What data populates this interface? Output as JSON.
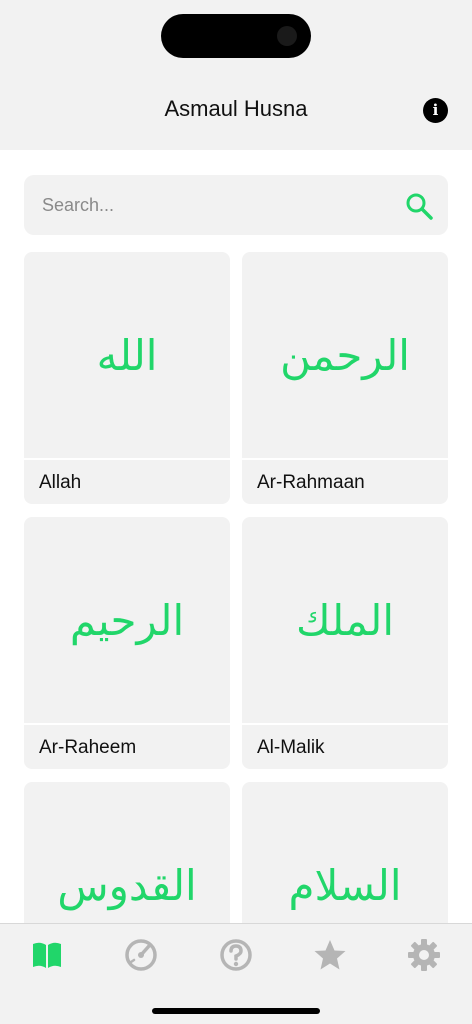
{
  "header": {
    "title": "Asmaul Husna",
    "info_icon": "info-icon"
  },
  "search": {
    "placeholder": "Search...",
    "icon": "search-icon"
  },
  "names": [
    {
      "arabic": "الله",
      "transliteration": "Allah"
    },
    {
      "arabic": "الرحمن",
      "transliteration": "Ar-Rahmaan"
    },
    {
      "arabic": "الرحيم",
      "transliteration": "Ar-Raheem"
    },
    {
      "arabic": "الملك",
      "transliteration": "Al-Malik"
    },
    {
      "arabic": "القدوس",
      "transliteration": ""
    },
    {
      "arabic": "السلام",
      "transliteration": ""
    }
  ],
  "tabs": [
    {
      "name": "book-icon",
      "active": true
    },
    {
      "name": "speedometer-icon",
      "active": false
    },
    {
      "name": "question-icon",
      "active": false
    },
    {
      "name": "star-icon",
      "active": false
    },
    {
      "name": "gear-icon",
      "active": false
    }
  ],
  "colors": {
    "accent": "#21d66a",
    "inactive_icon": "#b5b5b5",
    "surface": "#f2f2f2"
  }
}
